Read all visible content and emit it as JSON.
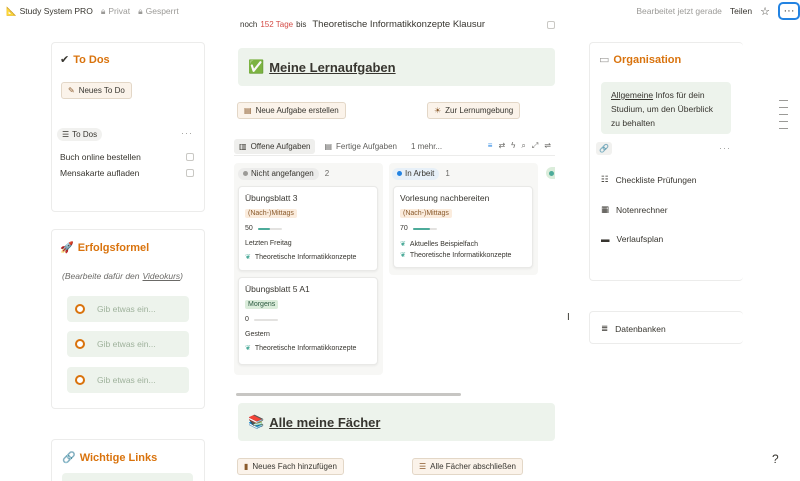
{
  "topbar": {
    "app_icon": "ruler-pencil-icon",
    "title": "Study System PRO",
    "privacy": "Privat",
    "lock": "Gesperrt",
    "edited": "Bearbeitet jetzt gerade",
    "share": "Teilen"
  },
  "countdown": {
    "prefix": "noch",
    "days": "152 Tage",
    "suffix": "bis",
    "event": "Theoretische Informatikkonzepte Klausur"
  },
  "todos": {
    "title": "To Dos",
    "new_button": "Neues To Do",
    "view_label": "To Dos",
    "items": [
      {
        "label": "Buch online bestellen"
      },
      {
        "label": "Mensakarte aufladen"
      }
    ]
  },
  "erfolgsformel": {
    "title": "Erfolgsformel",
    "hint_prefix": "(Bearbeite dafür den",
    "hint_link": "Videokurs",
    "hint_suffix": ")",
    "inputs": [
      {
        "placeholder": "Gib etwas ein..."
      },
      {
        "placeholder": "Gib etwas ein..."
      },
      {
        "placeholder": "Gib etwas ein..."
      }
    ]
  },
  "links": {
    "title": "Wichtige Links"
  },
  "lernaufgaben": {
    "banner": "Meine Lernaufgaben",
    "new_task": "Neue Aufgabe erstellen",
    "to_env": "Zur Lernumgebung",
    "tabs": [
      "Offene Aufgaben",
      "Fertige Aufgaben",
      "1 mehr..."
    ],
    "columns": [
      {
        "status": "Nicht angefangen",
        "count": "2",
        "dot_color": "#9b9a97",
        "bg": "#ececeb",
        "cards": [
          {
            "title": "Übungsblatt 3",
            "tag": "(Nach-)Mittags",
            "tag_type": "orange",
            "progress": "50",
            "date": "Letzten Freitag",
            "relations": [
              "Theoretische Informatikkonzepte"
            ]
          },
          {
            "title": "Übungsblatt 5 A1",
            "tag": "Morgens",
            "tag_type": "green",
            "progress": "0",
            "date": "Gestern",
            "relations": [
              "Theoretische Informatikkonzepte"
            ]
          }
        ]
      },
      {
        "status": "In Arbeit",
        "count": "1",
        "dot_color": "#2383e2",
        "bg": "#e7f0f8",
        "cards": [
          {
            "title": "Vorlesung nachbereiten",
            "tag": "(Nach-)Mittags",
            "tag_type": "orange",
            "progress": "70",
            "relations": [
              "Aktuelles Beispielfach",
              "Theoretische Informatikkonzepte"
            ]
          }
        ]
      }
    ]
  },
  "faecher": {
    "banner": "Alle meine Fächer",
    "new_subject": "Neues Fach hinzufügen",
    "finish_all": "Alle Fächer abschließen"
  },
  "organisation": {
    "title": "Organisation",
    "note_link": "Allgemeine",
    "note_rest": "Infos für dein Studium, um den Überblick zu behalten",
    "items": [
      {
        "label": "Checkliste Prüfungen",
        "icon": "checklist-icon"
      },
      {
        "label": "Notenrechner",
        "icon": "calculator-icon"
      },
      {
        "label": "Verlaufsplan",
        "icon": "briefcase-icon"
      }
    ],
    "databases": "Datenbanken"
  },
  "colors": {
    "accent_orange": "#d9730d",
    "green_bg": "#edf3ec",
    "blue_focus": "#2383e2"
  }
}
